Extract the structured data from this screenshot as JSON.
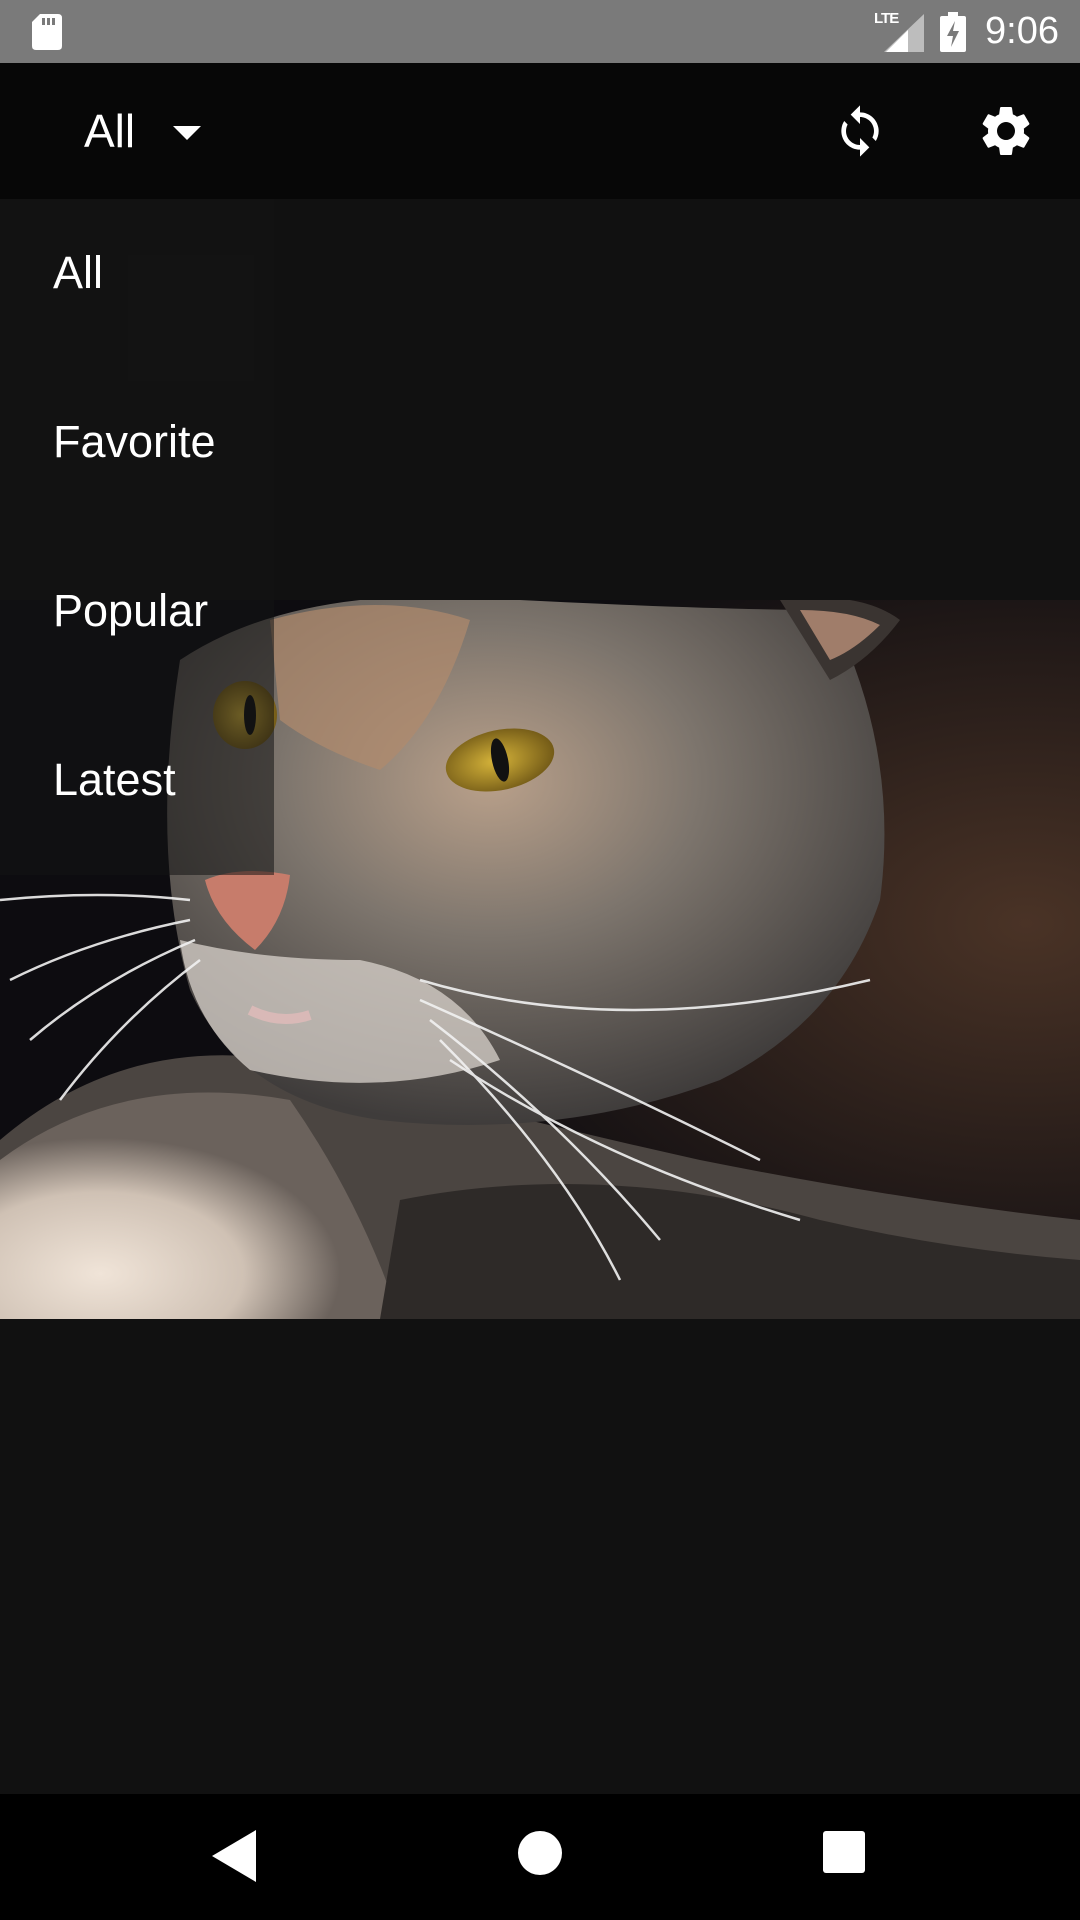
{
  "status_bar": {
    "network": "LTE",
    "time": "9:06",
    "icons": [
      "sd-card-icon",
      "lte-signal-icon",
      "battery-charging-icon"
    ]
  },
  "toolbar": {
    "filter_label": "All",
    "icons": [
      "dropdown-arrow-icon",
      "refresh-icon",
      "settings-gear-icon"
    ]
  },
  "filter_menu": {
    "items": [
      {
        "label": "All"
      },
      {
        "label": "Favorite"
      },
      {
        "label": "Popular"
      },
      {
        "label": "Latest"
      }
    ]
  },
  "nav_bar": {
    "icons": [
      "back-icon",
      "home-icon",
      "recents-icon"
    ]
  },
  "colors": {
    "status_bar": "#7a7a7a",
    "toolbar": "#070707",
    "background": "#111111",
    "nav_bar": "#000000",
    "text": "#ffffff"
  }
}
